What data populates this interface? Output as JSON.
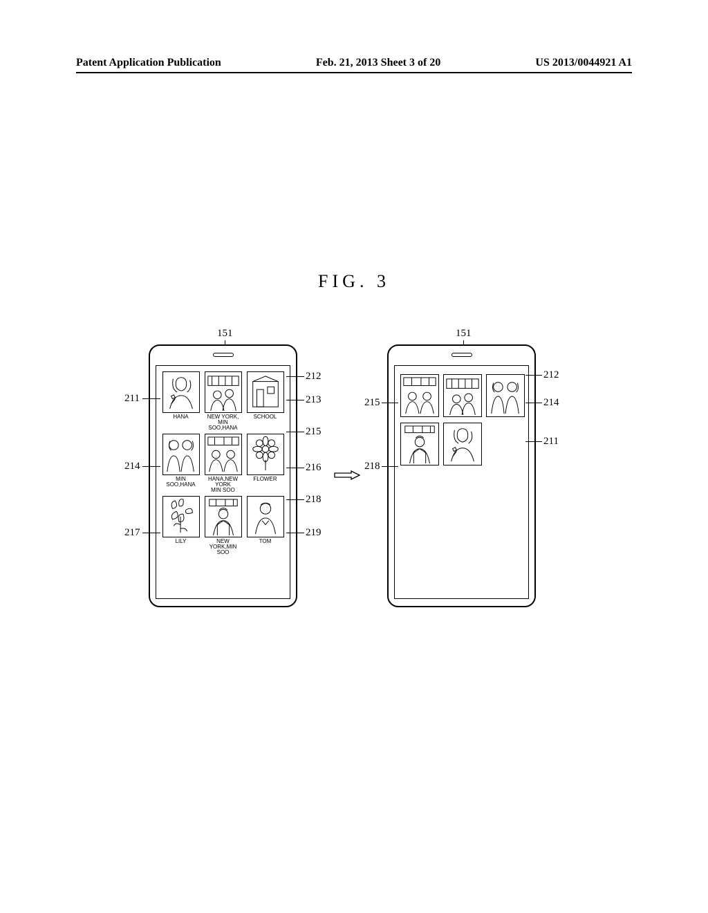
{
  "header": {
    "left": "Patent Application Publication",
    "center": "Feb. 21, 2013  Sheet 3 of 20",
    "right": "US 2013/0044921 A1"
  },
  "figure_title": "FIG. 3",
  "refs": {
    "r151a": "151",
    "r151b": "151",
    "r211": "211",
    "r212a": "212",
    "r212b": "212",
    "r213": "213",
    "r214a": "214",
    "r214b": "214",
    "r215a": "215",
    "r215b": "215",
    "r216": "216",
    "r217": "217",
    "r218a": "218",
    "r218b": "218",
    "r219": "219",
    "r211b": "211"
  },
  "captions": {
    "c211": "HANA",
    "c212": "NEW YORK,\nMIN SOO,HANA",
    "c213": "SCHOOL",
    "c214": "MIN SOO,HANA",
    "c215": "HANA,NEW YORK\nMIN SOO",
    "c216": "FLOWER",
    "c217": "LILY",
    "c218": "NEW YORK,MIN SOO",
    "c219": "TOM"
  }
}
